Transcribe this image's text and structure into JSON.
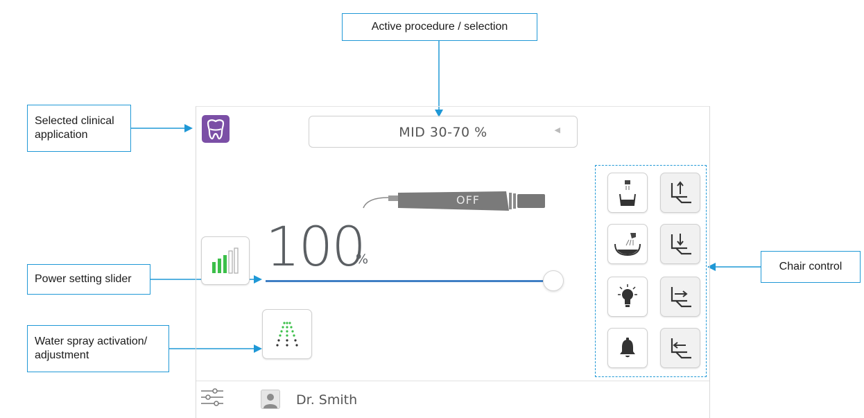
{
  "callouts": {
    "active_procedure": "Active procedure / selection",
    "clinical_app_line1": "Selected clinical",
    "clinical_app_line2": "application",
    "power_slider": "Power setting slider",
    "water_spray_line1": "Water spray activation/",
    "water_spray_line2": "adjustment",
    "chair_control": "Chair control"
  },
  "device": {
    "procedure_value": "MID 30-70 %",
    "handpiece_state": "OFF",
    "power_value": "100",
    "power_unit": "%",
    "power_level": 1.0,
    "user_name": "Dr. Smith",
    "app_icon": "tooth-icon",
    "accent_color": "#1f98d6",
    "app_color": "#7b4fa6",
    "power_bar_color": "#3f7fc4",
    "signal_green": "#3cbf4a"
  }
}
